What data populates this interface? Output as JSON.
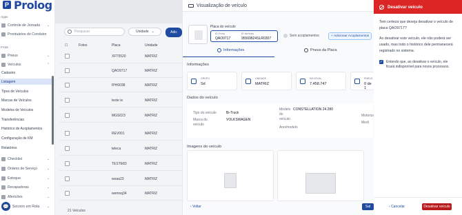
{
  "app": {
    "logo": "Prolog"
  },
  "sidebar": {
    "items": [
      {
        "label": "Controle de Jornada",
        "icon": "clock-icon"
      },
      {
        "label": "Prontuários do Condutor",
        "icon": "document-icon"
      }
    ],
    "section_frota": "Frota",
    "frota_items": [
      {
        "label": "Pneus",
        "icon": "tire-icon"
      },
      {
        "label": "Veículos",
        "icon": "truck-icon"
      }
    ],
    "sub_items": [
      "Cadastro",
      "Listagem",
      "Tipos de Veículos",
      "Marcas de Veículos",
      "Modelos de Veículos",
      "Transferências",
      "Histórico de Acoplamentos",
      "Configuração de KM",
      "Relatórios"
    ],
    "active_sub": "Listagem",
    "bottom_items": [
      {
        "label": "Checklist",
        "icon": "checklist-icon"
      },
      {
        "label": "Ordens de Serviço",
        "icon": "wrench-icon"
      },
      {
        "label": "Estoque",
        "icon": "box-icon"
      },
      {
        "label": "Recapadoras",
        "icon": "recap-icon"
      },
      {
        "label": "Afericões",
        "icon": "gauge-icon"
      },
      {
        "label": "Socorro em Rota",
        "icon": "alert-icon"
      }
    ]
  },
  "list": {
    "search_placeholder": "Pesquisar",
    "unit_filter": "Unidade",
    "action_button": "Adic",
    "columns": {
      "photo": "Fotos",
      "plate": "Placa",
      "unit": "Unidade"
    },
    "rows": [
      {
        "plate": "XFT5520",
        "unit": "MATRIZ"
      },
      {
        "plate": "QAO9717",
        "unit": "MATRIZ"
      },
      {
        "plate": "IPH0038",
        "unit": "MATRIZ"
      },
      {
        "plate": "teste ie",
        "unit": "MATRIZ"
      },
      {
        "plate": "MGS023",
        "unit": "MATRIZ"
      },
      {
        "plate": "REV001",
        "unit": "MATRIZ"
      },
      {
        "plate": "teleca",
        "unit": "MATRIZ"
      },
      {
        "plate": "TESTE83",
        "unit": "MATRIZ"
      },
      {
        "plate": "woaa23",
        "unit": "MATRIZ"
      },
      {
        "plate": "wemoq34",
        "unit": "MATRIZ"
      }
    ],
    "footer": "21 Veículos"
  },
  "vehicle_view": {
    "title": "Visualização de veículo",
    "vehicle_label": "Placa do veículo",
    "fields": {
      "frota_label": "ID Frota",
      "frota_value": "QAO9717",
      "frota_id_label": "ID da frota",
      "frota_id_value": "95569824SLR0307"
    },
    "no_attachments": "Sem acoplamentos",
    "add_attachment": "Adicionar Acoplamentos",
    "tabs": {
      "info": "Informações",
      "tyres": "Pneus da Placa"
    },
    "info_section": "Informações",
    "cards": [
      {
        "label": "GRUPO",
        "value": "Sd",
        "icon": "group-icon"
      },
      {
        "label": "UNIDADE",
        "value": "MATRIZ",
        "icon": "location-icon"
      },
      {
        "label": "KM ATUAL",
        "value": "7.458.747",
        "icon": "odometer-icon"
      },
      {
        "label": "PNEUS",
        "value": "0 de 1",
        "icon": "tire-icon"
      }
    ],
    "data_section": "Dados do veículo",
    "data": {
      "type_label": "Tipo do veículo",
      "type_value": "Bi-Truck",
      "brand_label": "Marca do veículo",
      "brand_value": "VOLKSWAGEN",
      "model_label": "Modelo do veículo",
      "model_value": "CONSTELLATION 24.280",
      "year_label": "Ano/modelo",
      "extra1": "Motorizaç",
      "extra2": "Medi"
    },
    "images_section": "Imagens do veículo",
    "back": "Voltar",
    "save": "Sal"
  },
  "modal": {
    "title": "Desativar veículo",
    "question": "Tem certeza que deseja desativar o veículo de placa QAO9717?",
    "explanation": "Ao desativar este veículo, ele não poderá ser usado, mas todo o histórico dele permanecerá registrado no sistema.",
    "checkbox_label": "Entendo que, ao desativar o veículo, ele ficará indisponível para novos processos.",
    "cancel": "Cancelar",
    "confirm": "Desativar veículo"
  },
  "colors": {
    "primary": "#1e4ba0",
    "danger": "#dc2626",
    "danger_dark": "#b91c1c"
  }
}
